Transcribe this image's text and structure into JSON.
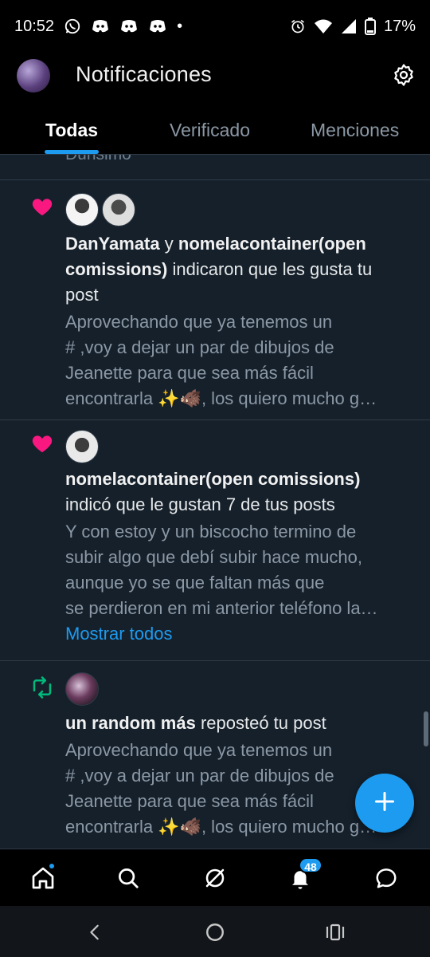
{
  "status_bar": {
    "time": "10:52",
    "battery_pct": "17%",
    "dot": "•",
    "icons": [
      "whatsapp-icon",
      "discord-icon",
      "discord-icon",
      "discord-icon",
      "alarm-icon",
      "wifi-icon",
      "signal-icon",
      "battery-icon"
    ]
  },
  "header": {
    "title": "Notificaciones",
    "settings_icon": "gear-icon",
    "tabs": [
      {
        "label": "Todas",
        "active": true
      },
      {
        "label": "Verificado",
        "active": false
      },
      {
        "label": "Menciones",
        "active": false
      }
    ]
  },
  "feed": {
    "previous_tail": "Dunsimo",
    "notifications": [
      {
        "type": "like",
        "icon": "heart-icon",
        "user1": "DanYamata",
        "connector": "y",
        "user2_line1": "nomelacontainer(open",
        "user2_line2": "comissions)",
        "action_line2": "indicaron que les gusta tu",
        "action_line3": "post",
        "preview": [
          "Aprovechando que ya tenemos un",
          "# ,voy a dejar un par de dibujos de",
          "Jeanette para que sea más fácil",
          "encontrarla ✨🐗, los quiero mucho g…"
        ]
      },
      {
        "type": "like",
        "icon": "heart-icon",
        "user": "nomelacontainer(open comissions)",
        "action": "indicó que le gustan 7 de tus posts",
        "preview": [
          "Y con estoy y un biscocho termino de",
          "subir algo que debí subir hace mucho,",
          "aunque yo se que faltan más que",
          "se perdieron en mi anterior teléfono la…"
        ],
        "show_all": "Mostrar todos"
      },
      {
        "type": "repost",
        "icon": "repost-icon",
        "user": "un random más",
        "action": "reposteó tu post",
        "preview": [
          "Aprovechando que ya tenemos un",
          "# ,voy a dejar un par de dibujos de",
          "Jeanette para que sea más fácil",
          "encontrarla ✨🐗, los quiero mucho g…"
        ]
      }
    ]
  },
  "fab": {
    "icon": "plus-icon"
  },
  "bottom_nav": {
    "items": [
      "home-icon",
      "search-icon",
      "grok-icon",
      "bell-icon",
      "messages-icon"
    ],
    "notifications_badge": "48"
  },
  "colors": {
    "accent": "#1d9bf0",
    "like": "#f91880",
    "repost": "#00ba7c",
    "background": "#15202b"
  }
}
